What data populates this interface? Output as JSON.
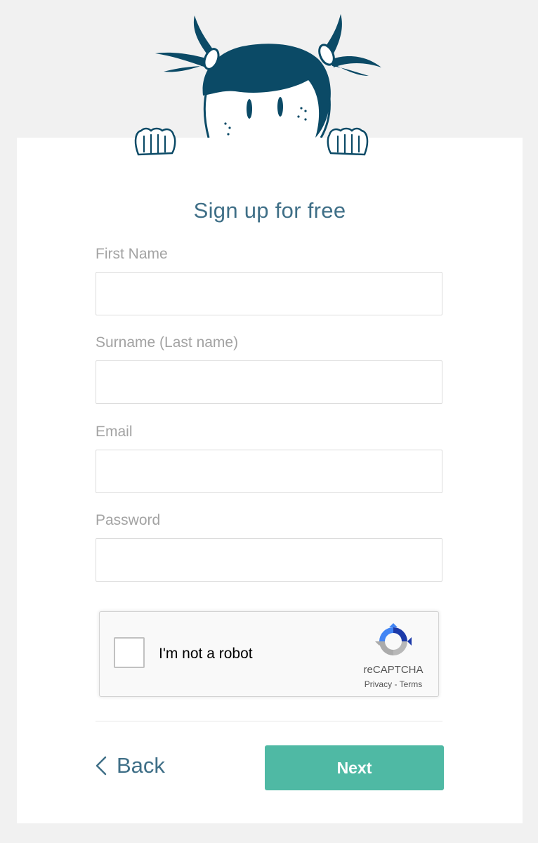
{
  "form": {
    "title": "Sign up for free",
    "fields": [
      {
        "label": "First Name",
        "value": "",
        "placeholder": ""
      },
      {
        "label": "Surname (Last name)",
        "value": "",
        "placeholder": ""
      },
      {
        "label": "Email",
        "value": "",
        "placeholder": ""
      },
      {
        "label": "Password",
        "value": "",
        "placeholder": ""
      }
    ]
  },
  "captcha": {
    "label": "I'm not a robot",
    "brand": "reCAPTCHA",
    "privacy": "Privacy",
    "separator": "-",
    "terms": "Terms",
    "checked": false
  },
  "actions": {
    "back_label": "Back",
    "next_label": "Next"
  },
  "colors": {
    "accent": "#4fb9a4",
    "title": "#3f6f87",
    "mascot": "#0b4a66",
    "background": "#f1f1f1"
  },
  "icons": {
    "mascot": "girl-mascot-illustration",
    "back": "chevron-left-icon",
    "captcha_logo": "recaptcha-logo-icon"
  }
}
